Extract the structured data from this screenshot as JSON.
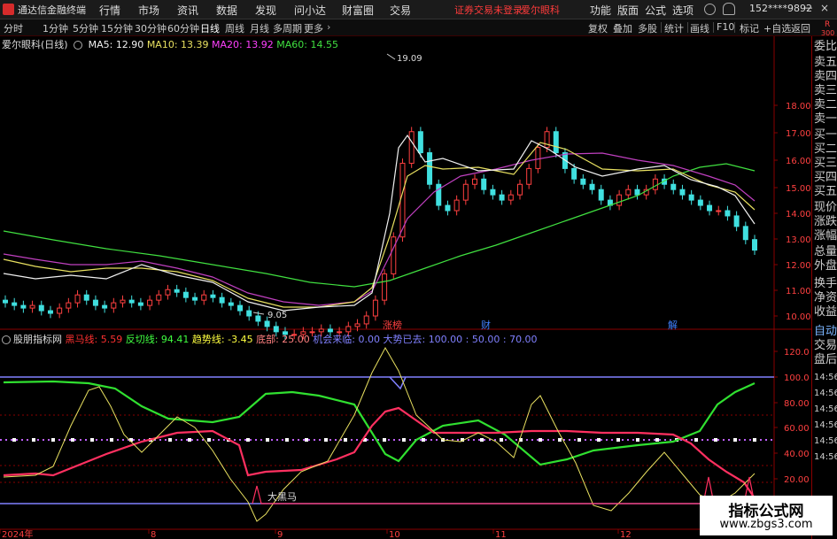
{
  "app": {
    "title": "通达信金融终端",
    "menu": [
      "行情",
      "市场",
      "资讯",
      "数据",
      "发现",
      "问小达",
      "财富圈",
      "交易"
    ],
    "alert": "证券交易未登录",
    "stock_tab": "爱尔眼科",
    "right_menu": [
      "功能",
      "版面",
      "公式",
      "选项"
    ],
    "account": "152****9892"
  },
  "toolbar": {
    "periods": [
      "分时",
      "1分钟",
      "5分钟",
      "15分钟",
      "30分钟",
      "60分钟",
      "日线",
      "周线",
      "月线",
      "多周期",
      "更多"
    ],
    "active_period": "日线",
    "right_buttons": [
      "复权",
      "叠加",
      "多股",
      "统计",
      "画线",
      "F10",
      "标记",
      "+自选",
      "返回"
    ]
  },
  "right_panel": {
    "items": [
      "委比",
      "卖五",
      "卖四",
      "卖三",
      "卖二",
      "卖一",
      "买一",
      "买二",
      "买三",
      "买四",
      "买五",
      "现价",
      "涨跌",
      "涨幅",
      "总量",
      "外盘",
      "换手",
      "净资",
      "收益",
      "自动",
      "交易",
      "盘后"
    ],
    "times": [
      "14:56",
      "14:56",
      "14:56",
      "14:56",
      "14:56",
      "14:56"
    ],
    "corner_r": "R",
    "corner_code": "300"
  },
  "price_chart": {
    "stock_name": "爱尔眼科",
    "period_tag": "(日线)",
    "ma": [
      {
        "label": "MA5",
        "value": "12.90",
        "color": "#f0f0f0"
      },
      {
        "label": "MA10",
        "value": "13.39",
        "color": "#e8e060"
      },
      {
        "label": "MA20",
        "value": "13.92",
        "color": "#ff40ff"
      },
      {
        "label": "MA60",
        "value": "14.55",
        "color": "#40e040"
      }
    ],
    "y_ticks": [
      "18.00",
      "17.00",
      "16.00",
      "15.00",
      "14.00",
      "13.00",
      "12.00",
      "11.00",
      "10.00"
    ],
    "high_label": "19.09",
    "low_label": "9.05",
    "tags": [
      "涨",
      "榜",
      "财",
      "解"
    ]
  },
  "indicator": {
    "name": "股朋指标网",
    "lines": [
      {
        "label": "黑马线",
        "value": "5.59",
        "color": "#ff3030"
      },
      {
        "label": "反切线",
        "value": "94.41",
        "color": "#40ff40"
      },
      {
        "label": "趋势线",
        "value": "-3.45",
        "color": "#ffff40"
      },
      {
        "label": "底部",
        "value": "25.00",
        "color": "#ff8080"
      },
      {
        "label": "机会来临",
        "value": "0.00",
        "color": "#8080ff"
      },
      {
        "label": "大势已去",
        "value": "100.00 : 50.00 : 70.00",
        "color": "#8080ff"
      }
    ],
    "y_ticks": [
      "120.0",
      "100.0",
      "80.00",
      "60.00",
      "40.00",
      "20.00"
    ],
    "annotation": "大黑马"
  },
  "x_axis": {
    "labels": [
      "2024年",
      "8",
      "9",
      "10",
      "11",
      "12"
    ]
  },
  "watermark": {
    "title": "指标公式网",
    "url": "www.zbgs3.com"
  },
  "colors": {
    "up": "#ff4040",
    "down": "#40e0e0",
    "axis": "#8a0000"
  }
}
